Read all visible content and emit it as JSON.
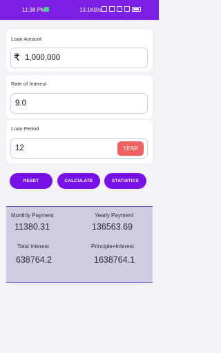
{
  "status_bar": {
    "time": "11:38 PM",
    "network_speed": "13.1KB/s"
  },
  "loan_amount": {
    "label": "Loan Amount",
    "currency_symbol": "₹",
    "value": "1,000,000"
  },
  "rate_of_interest": {
    "label": "Rate of Interest",
    "value": "9.0"
  },
  "loan_period": {
    "label": "Loan Period",
    "value": "12",
    "unit_button": "YEAR"
  },
  "actions": {
    "reset": "RESET",
    "calculate": "CALCULATE",
    "statistics": "STATISTICS"
  },
  "results": {
    "monthly_payment_label": "Monthly Payment",
    "monthly_payment": "11380.31",
    "yearly_payment_label": "Yearly Payment",
    "yearly_payment": "136563.69",
    "total_interest_label": "Total Interest",
    "total_interest": "638764.2",
    "principle_interest_label": "Principle+Interest",
    "principle_interest": "1638764.1"
  },
  "colors": {
    "accent": "#7810e8",
    "year_button": "#f06262",
    "results_bg": "#cfcce2"
  }
}
